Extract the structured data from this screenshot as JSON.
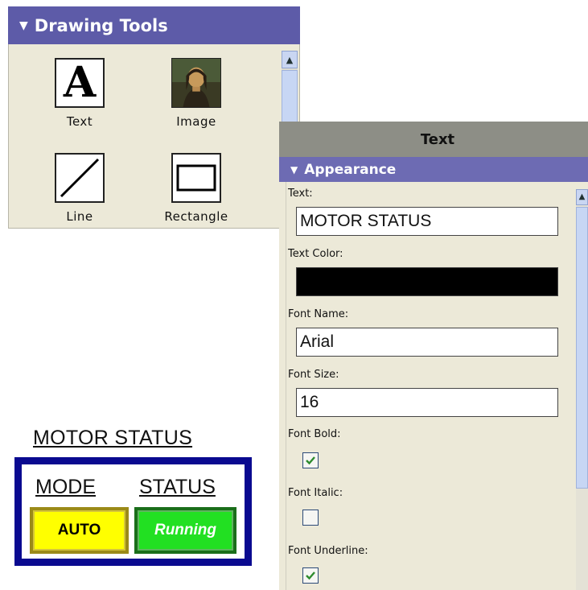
{
  "drawing_tools": {
    "title": "Drawing Tools",
    "tools": [
      {
        "label": "Text",
        "icon": "text-icon"
      },
      {
        "label": "Image",
        "icon": "image-icon"
      },
      {
        "label": "Line",
        "icon": "line-icon"
      },
      {
        "label": "Rectangle",
        "icon": "rectangle-icon"
      }
    ],
    "text_icon_glyph": "A"
  },
  "properties": {
    "title": "Text",
    "section": "Appearance",
    "fields": {
      "text_label": "Text:",
      "text_value": "MOTOR STATUS",
      "text_color_label": "Text Color:",
      "text_color_value": "#000000",
      "font_name_label": "Font Name:",
      "font_name_value": "Arial",
      "font_size_label": "Font Size:",
      "font_size_value": "16",
      "font_bold_label": "Font Bold:",
      "font_bold_checked": true,
      "font_italic_label": "Font Italic:",
      "font_italic_checked": false,
      "font_underline_label": "Font Underline:",
      "font_underline_checked": true
    }
  },
  "preview": {
    "title": "MOTOR STATUS",
    "mode_header": "MODE",
    "status_header": "STATUS",
    "mode_button": "AUTO",
    "status_button": "Running"
  },
  "colors": {
    "drawing_tools_header": "#5d5ba8",
    "properties_title_bar": "#8d8e86",
    "section_header": "#6d6bb3",
    "frame_blue": "#0a0a90",
    "auto_yellow": "#ffff00",
    "running_green": "#22e022"
  }
}
